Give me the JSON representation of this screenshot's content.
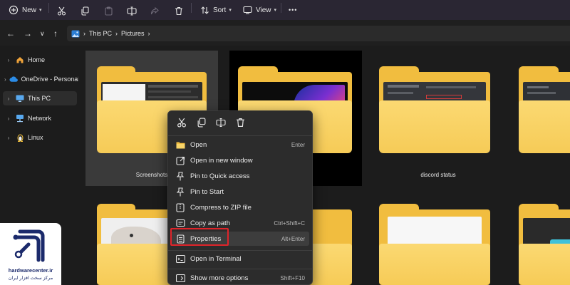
{
  "toolbar": {
    "new_label": "New",
    "sort_label": "Sort",
    "view_label": "View",
    "more_label": "•••"
  },
  "breadcrumb": {
    "items": [
      "This PC",
      "Pictures"
    ]
  },
  "sidebar": {
    "items": [
      {
        "label": "Home",
        "icon": "home-icon"
      },
      {
        "label": "OneDrive - Personal",
        "icon": "cloud-icon"
      },
      {
        "label": "This PC",
        "icon": "computer-icon"
      },
      {
        "label": "Network",
        "icon": "network-icon"
      },
      {
        "label": "Linux",
        "icon": "linux-icon"
      }
    ]
  },
  "folders": [
    {
      "label": "Screenshots"
    },
    {
      "label": ""
    },
    {
      "label": "discord status"
    },
    {
      "label": ""
    }
  ],
  "context_menu": {
    "top_actions": [
      "cut-icon",
      "copy-icon",
      "rename-icon",
      "delete-icon"
    ],
    "items": [
      {
        "label": "Open",
        "shortcut": "Enter",
        "icon": "folder-open-icon"
      },
      {
        "label": "Open in new window",
        "shortcut": "",
        "icon": "new-window-icon"
      },
      {
        "label": "Pin to Quick access",
        "shortcut": "",
        "icon": "pin-icon"
      },
      {
        "label": "Pin to Start",
        "shortcut": "",
        "icon": "pin-start-icon"
      },
      {
        "label": "Compress to ZIP file",
        "shortcut": "",
        "icon": "zip-icon"
      },
      {
        "label": "Copy as path",
        "shortcut": "Ctrl+Shift+C",
        "icon": "copy-path-icon"
      },
      {
        "label": "Properties",
        "shortcut": "Alt+Enter",
        "icon": "properties-icon"
      },
      {
        "label": "Open in Terminal",
        "shortcut": "",
        "icon": "terminal-icon"
      },
      {
        "label": "Show more options",
        "shortcut": "Shift+F10",
        "icon": "more-options-icon"
      }
    ]
  },
  "watermark": {
    "line1": "hardwarecenter.ir",
    "line2": "مرکز سخت افزار ایران"
  },
  "colors": {
    "folder": "#f1bd3f",
    "highlight_border": "#e0242a",
    "toolbar_bg": "#2a2633"
  }
}
